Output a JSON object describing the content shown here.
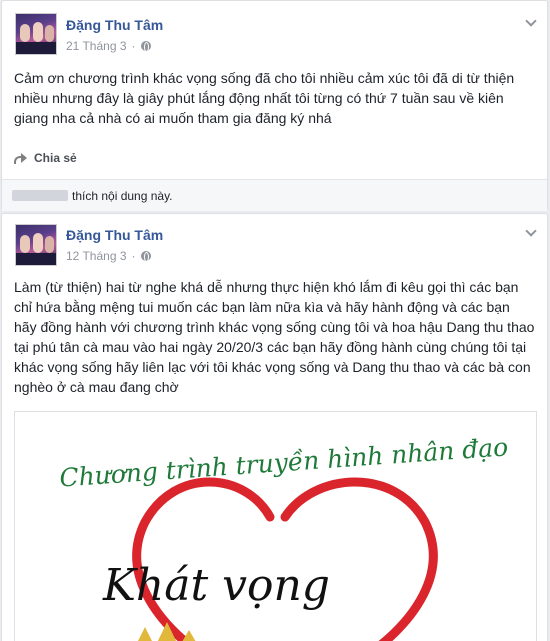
{
  "posts": [
    {
      "author": "Đặng Thu Tâm",
      "date": "21 Tháng 3",
      "text": "Cảm ơn chương trình khác vọng sống đã cho tôi nhiều cảm xúc tôi đã di từ thiện nhiều nhưng đây là giây phút lắng động nhất tôi từng có thứ 7 tuần sau về kiên giang nha cả nhà có ai muốn tham gia đăng ký nhá",
      "share_label": "Chia sẻ",
      "likes_text": "thích nội dung này."
    },
    {
      "author": "Đặng Thu Tâm",
      "date": "12 Tháng 3",
      "text": "Làm (từ thiện) hai từ nghe khá dễ nhưng thực hiện khó lắm đi kêu gọi thì các bạn chỉ hứa bằng mệng tui muốn các bạn làm nữa kìa và hãy hành động và các bạn hãy đồng hành với chương trình khác vọng sống cùng tôi và hoa hậu Dang thu thao tại phú tân cà mau vào hai ngày 20/20/3 các bạn hãy đồng hành cùng chúng tôi tại khác vọng sống hãy liên lạc với tôi khác vọng sống và Dang thu thao và các bà con nghèo ở cà mau đang chờ",
      "image_headline": "Chương trình truyền hình nhân đạo",
      "image_title": "Khát vọng"
    }
  ],
  "colors": {
    "author_link": "#365899",
    "meta_gray": "#90949c",
    "image_headline": "#1f7a3a",
    "heart_red": "#d9252b"
  },
  "icons": [
    "globe-icon",
    "chevron-down-icon",
    "share-icon"
  ]
}
